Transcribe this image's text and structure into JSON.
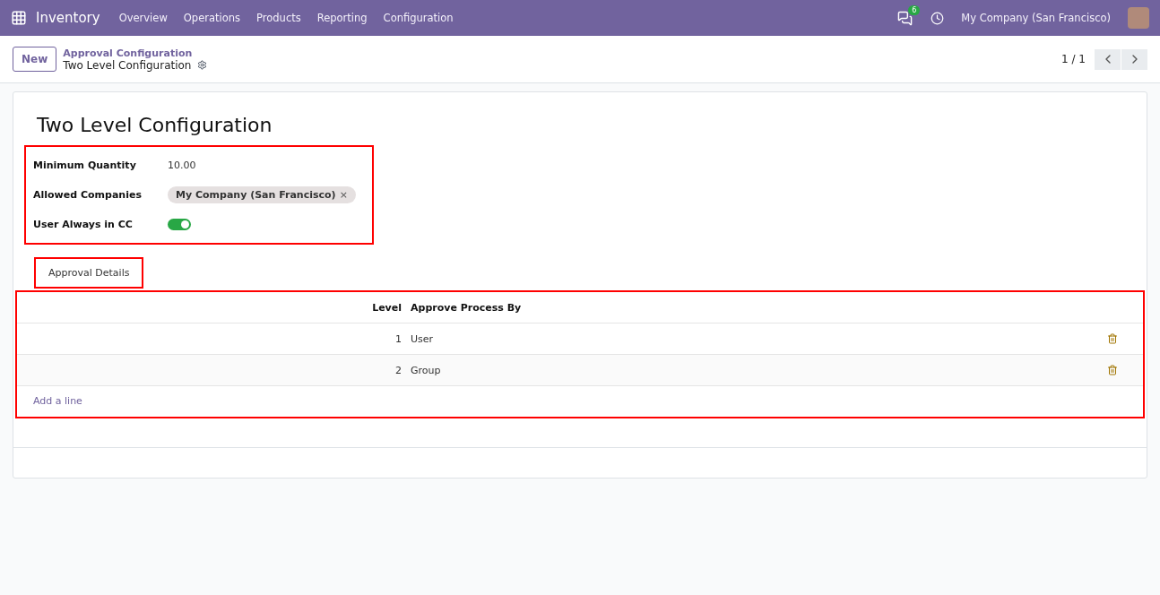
{
  "navbar": {
    "app": "Inventory",
    "menu": [
      "Overview",
      "Operations",
      "Products",
      "Reporting",
      "Configuration"
    ],
    "message_count": "6",
    "company": "My Company (San Francisco)"
  },
  "control_panel": {
    "new_button": "New",
    "breadcrumb": "Approval Configuration",
    "record": "Two Level Configuration",
    "pager": "1 / 1"
  },
  "form": {
    "title": "Two Level Configuration",
    "fields": [
      {
        "kind": "text",
        "label": "Minimum Quantity",
        "value": "10.00"
      },
      {
        "kind": "tags",
        "label": "Allowed Companies",
        "tags": [
          "My Company (San Francisco)"
        ],
        "remove": "×"
      },
      {
        "kind": "toggle",
        "label": "User Always in CC",
        "on": true
      }
    ],
    "tabs": [
      {
        "label": "Approval Details",
        "selected": true
      }
    ],
    "table": {
      "columns": [
        "Level",
        "Approve Process By"
      ],
      "rows": [
        {
          "level": "1",
          "by": "User"
        },
        {
          "level": "2",
          "by": "Group"
        }
      ],
      "add_line": "Add a line"
    }
  }
}
